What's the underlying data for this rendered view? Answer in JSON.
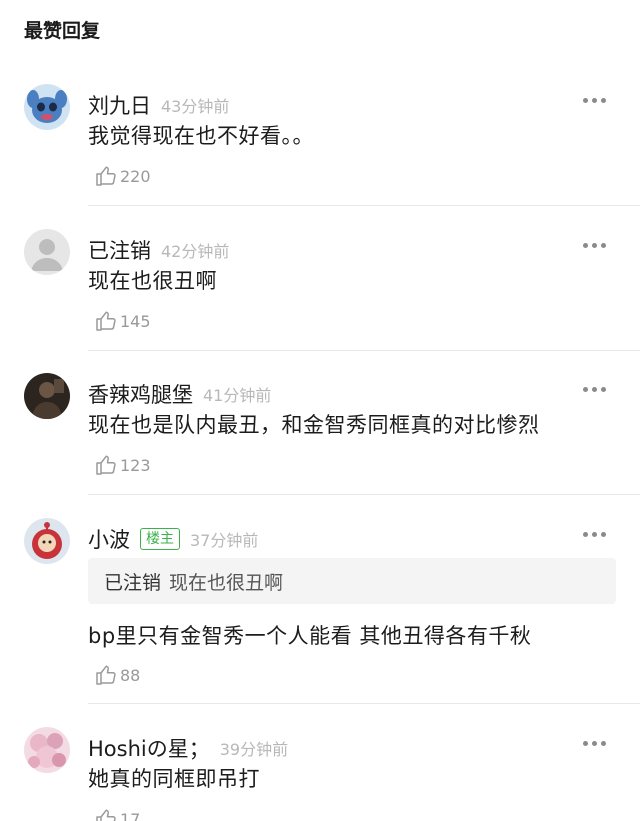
{
  "section_title": "最赞回复",
  "comments": [
    {
      "username": "刘九日",
      "time": "43分钟前",
      "text": "我觉得现在也不好看。。",
      "likes": "220",
      "avatar_icon": "stitch-avatar",
      "avatar_color": "#4a7fc1"
    },
    {
      "username": "已注销",
      "time": "42分钟前",
      "text": "现在也很丑啊",
      "likes": "145",
      "avatar_icon": "default-user-avatar",
      "avatar_color": "#d9d9d9"
    },
    {
      "username": "香辣鸡腿堡",
      "time": "41分钟前",
      "text": "现在也是队内最丑，和金智秀同框真的对比惨烈",
      "likes": "123",
      "avatar_icon": "photo-avatar",
      "avatar_color": "#3a2f28"
    },
    {
      "username": "小波",
      "op_badge": "楼主",
      "time": "37分钟前",
      "quote_user": "已注销",
      "quote_text": "现在也很丑啊",
      "text": "bp里只有金智秀一个人能看 其他丑得各有千秋",
      "likes": "88",
      "avatar_icon": "teletubby-avatar",
      "avatar_color": "#c8323a"
    },
    {
      "username": "Hoshiの星；",
      "time": "39分钟前",
      "text": "她真的同框即吊打",
      "likes": "17",
      "avatar_icon": "pink-avatar",
      "avatar_color": "#e9b7c7"
    }
  ],
  "colors": {
    "op_badge": "#3bb34a",
    "muted_text": "#b8b8b8",
    "divider": "#e8e8e8",
    "quote_bg": "#f4f4f4"
  }
}
